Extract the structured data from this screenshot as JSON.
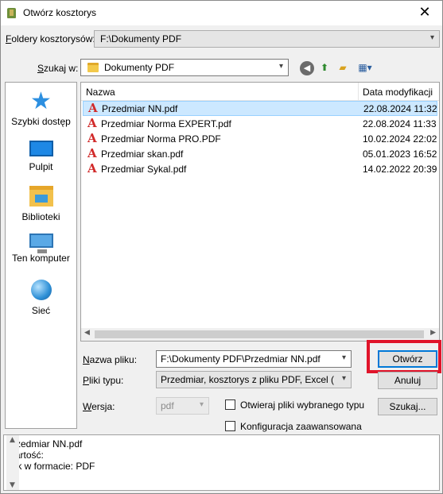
{
  "window": {
    "title": "Otwórz kosztorys",
    "close_label": "✕"
  },
  "folders": {
    "label_prefix": "F",
    "label_rest": "oldery kosztorysów:",
    "value": "F:\\Dokumenty PDF"
  },
  "search_in": {
    "label_prefix": "S",
    "label_rest": "zukaj w:",
    "value": "Dokumenty PDF"
  },
  "toolbar": {
    "back_icon": "back-arrow-icon",
    "up_icon": "up-folder-icon",
    "new_folder_icon": "new-folder-icon",
    "view_icon": "view-menu-icon"
  },
  "places": [
    {
      "label": "Szybki dostęp",
      "icon": "star-icon"
    },
    {
      "label": "Pulpit",
      "icon": "desktop-icon"
    },
    {
      "label": "Biblioteki",
      "icon": "libraries-icon"
    },
    {
      "label": "Ten komputer",
      "icon": "computer-icon"
    },
    {
      "label": "Sieć",
      "icon": "network-icon"
    }
  ],
  "files": {
    "columns": [
      "Nazwa",
      "Data modyfikacji"
    ],
    "rows": [
      {
        "name": "Przedmiar NN.pdf",
        "date": "22.08.2024 11:32",
        "selected": true
      },
      {
        "name": "Przedmiar Norma EXPERT.pdf",
        "date": "22.08.2024 11:33",
        "selected": false
      },
      {
        "name": "Przedmiar Norma PRO.PDF",
        "date": "10.02.2024 22:02",
        "selected": false
      },
      {
        "name": "Przedmiar skan.pdf",
        "date": "05.01.2023 16:52",
        "selected": false
      },
      {
        "name": "Przedmiar Sykal.pdf",
        "date": "14.02.2022 20:39",
        "selected": false
      }
    ],
    "file_icon": "pdf-icon",
    "file_icon_glyph": "A"
  },
  "filename": {
    "label_prefix": "N",
    "label_rest": "azwa pliku:",
    "value": "F:\\Dokumenty PDF\\Przedmiar NN.pdf"
  },
  "filetype": {
    "label_prefix": "P",
    "label_rest": "liki typu:",
    "value": "Przedmiar, kosztorys z pliku PDF, Excel (*.pdf;*."
  },
  "version": {
    "label_prefix": "W",
    "label_rest": "ersja:",
    "value": "pdf"
  },
  "options": {
    "open_selected_type": "Otwieraj pliki wybranego typu",
    "advanced_config": "Konfiguracja zaawansowana"
  },
  "buttons": {
    "open": "Otwórz",
    "cancel": "Anuluj",
    "search_prefix": "Szuka",
    "search_underlined": "j",
    "search_suffix": "..."
  },
  "info": {
    "line1": "Przedmiar NN.pdf",
    "line2": "Wartość:",
    "line3": "Plik w formacie: PDF"
  },
  "colors": {
    "selection": "#cce8ff",
    "highlight_box": "#e0142a",
    "pdf_icon": "#d12a2a"
  }
}
